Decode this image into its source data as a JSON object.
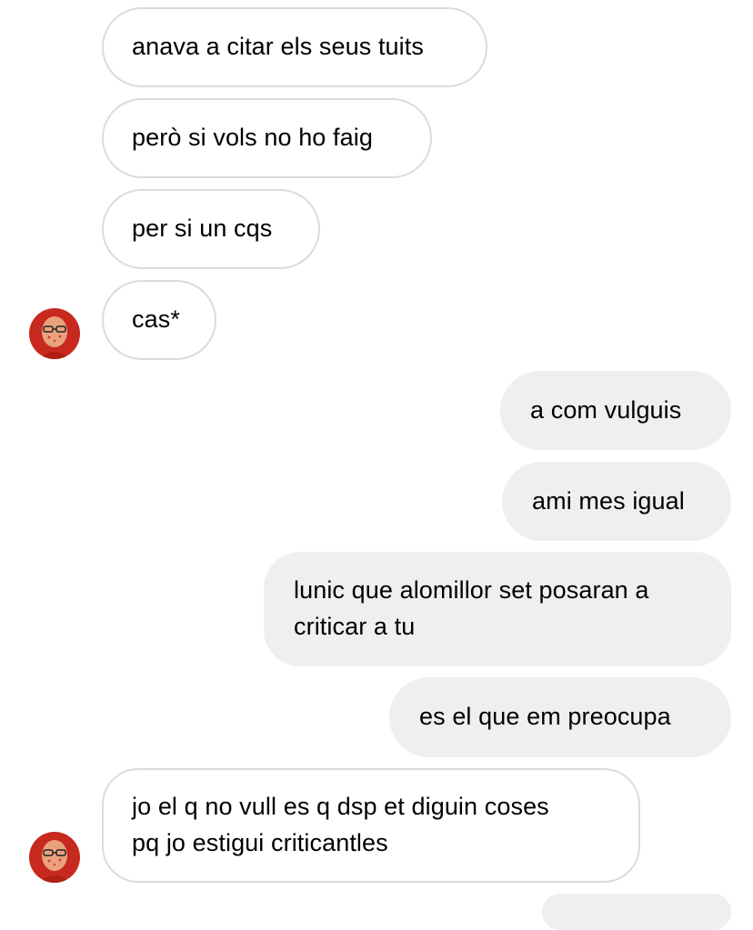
{
  "conversation": {
    "messages": [
      {
        "from": "them",
        "text": "anava a citar els seus tuits"
      },
      {
        "from": "them",
        "text": "però si vols no ho faig"
      },
      {
        "from": "them",
        "text": "per si un cqs"
      },
      {
        "from": "them",
        "text": "cas*"
      },
      {
        "from": "me",
        "text": "a com vulguis"
      },
      {
        "from": "me",
        "text": "ami mes igual"
      },
      {
        "from": "me",
        "lines": [
          "lunic que alomillor set posaran a",
          "criticar a tu"
        ]
      },
      {
        "from": "me",
        "text": "es el que em preocupa"
      },
      {
        "from": "them",
        "lines": [
          "jo el q no vull es q dsp et diguin coses",
          "pq jo estigui criticantles"
        ]
      }
    ]
  },
  "colors": {
    "received_bubble_bg": "#ffffff",
    "received_bubble_border": "#dbdbdb",
    "sent_bubble_bg": "#efefef",
    "text": "#000000"
  }
}
